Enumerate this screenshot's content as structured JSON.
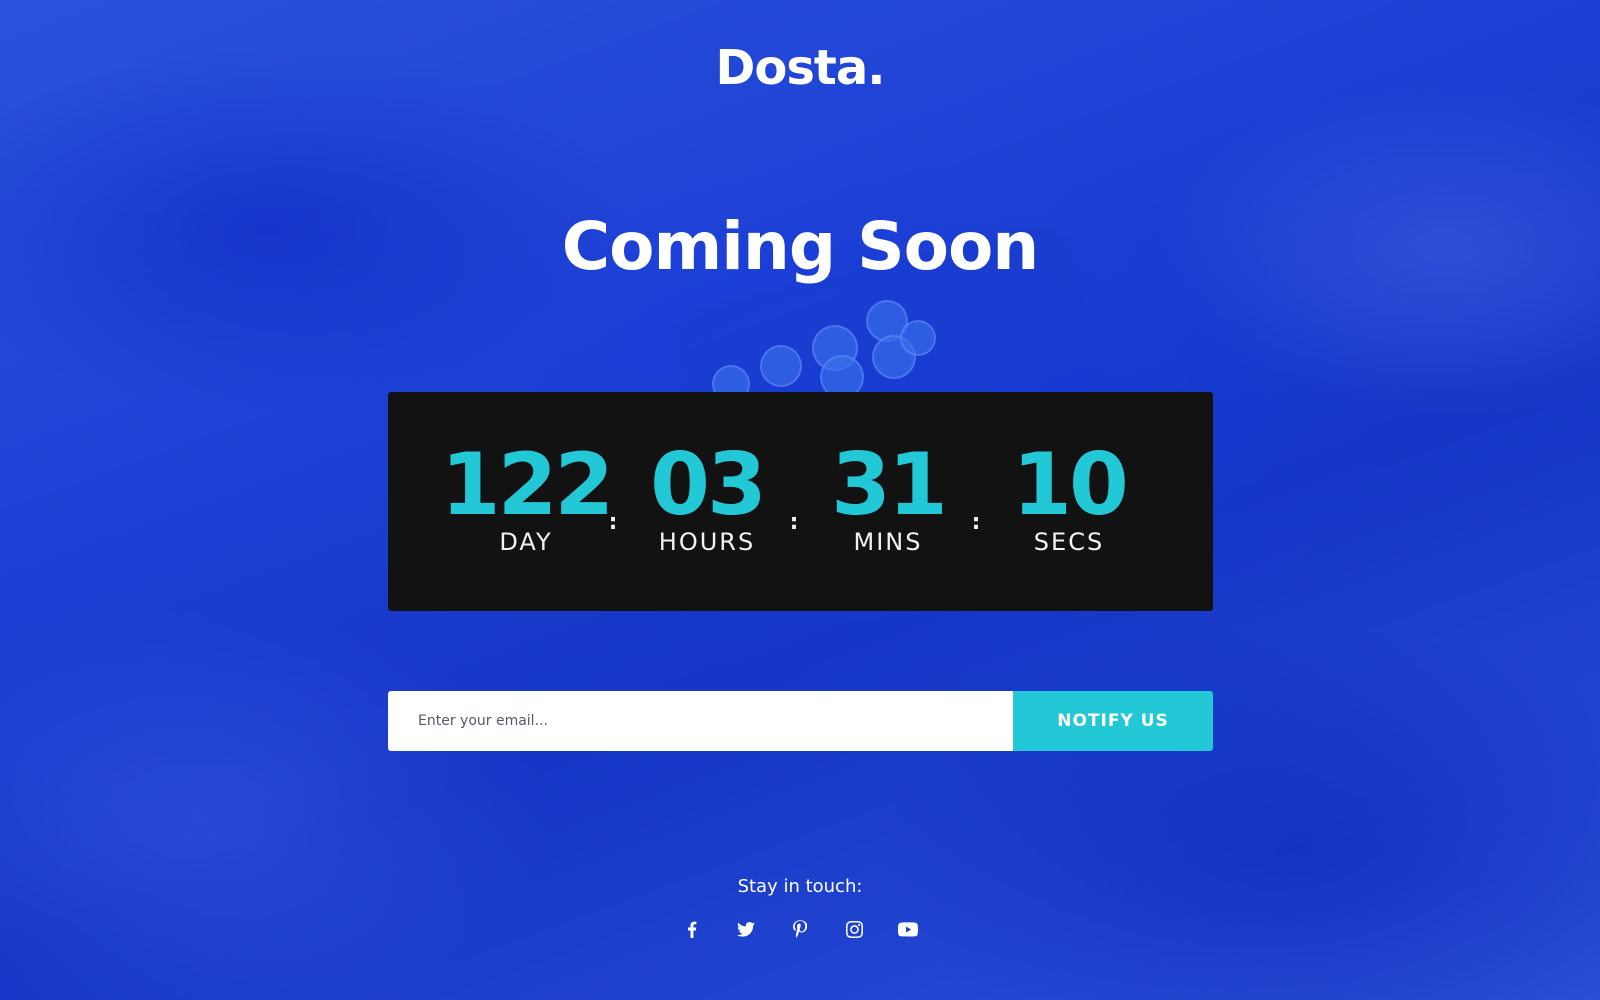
{
  "brand": {
    "logo": "Dosta."
  },
  "hero": {
    "title": "Coming Soon"
  },
  "countdown": {
    "units": [
      {
        "value": "122",
        "label": "DAY"
      },
      {
        "value": "03",
        "label": "HOURS"
      },
      {
        "value": "31",
        "label": "MINS"
      },
      {
        "value": "10",
        "label": "SECS"
      }
    ],
    "separator": ":"
  },
  "subscribe": {
    "placeholder": "Enter your email...",
    "button_label": "NOTIFY US"
  },
  "footer": {
    "stay_in_touch": "Stay in touch:",
    "social": [
      "facebook-icon",
      "twitter-icon",
      "pinterest-icon",
      "instagram-icon",
      "youtube-icon"
    ]
  },
  "colors": {
    "background": "#1f47d8",
    "accent": "#22c8d6",
    "panel": "#121212"
  }
}
